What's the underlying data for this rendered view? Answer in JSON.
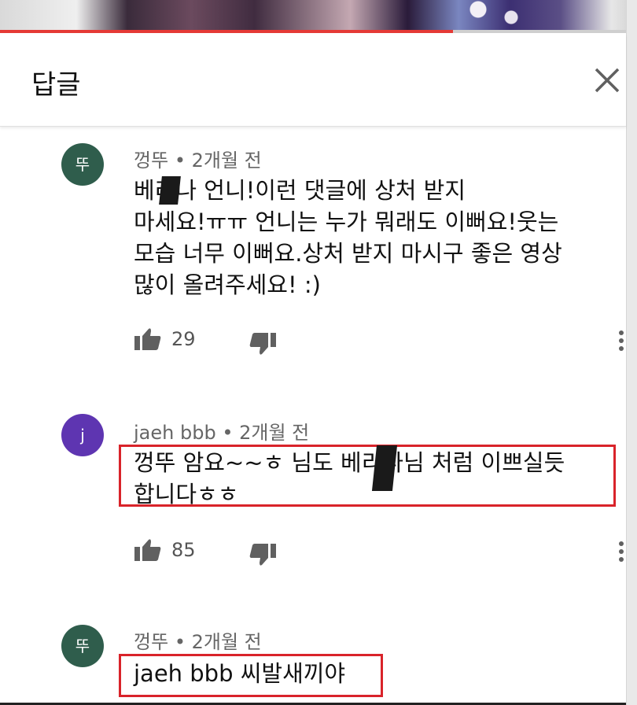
{
  "player": {
    "progress_percent": 72
  },
  "header": {
    "title": "답글"
  },
  "icons": {
    "close": "close-icon",
    "like": "thumbs-up-icon",
    "dislike": "thumbs-down-icon",
    "more": "more-vertical-icon"
  },
  "colors": {
    "avatar_1": "#2f5d4c",
    "avatar_2": "#5e35b1",
    "highlight": "#d9232a",
    "progress": "#e53935"
  },
  "comments": [
    {
      "avatar_letter": "뚜",
      "author": "껑뚜",
      "time": "2개월 전",
      "lines": [
        "베리나 언니!이런 댓글에 상처 받지",
        "마세요!ㅠㅠ 언니는 누가 뭐래도 이뻐요!웃는",
        "모습 너무 이뻐요.상처 받지 마시구 좋은 영상",
        "많이 올려주세요! :)"
      ],
      "likes": "29"
    },
    {
      "avatar_letter": "j",
      "author": "jaeh bbb",
      "time": "2개월 전",
      "lines": [
        "껑뚜 암요~~ㅎ 님도 베리나님 처럼 이쁘실듯",
        "합니다ㅎㅎ"
      ],
      "likes": "85"
    },
    {
      "avatar_letter": "뚜",
      "author": "껑뚜",
      "time": "2개월 전",
      "lines": [
        "jaeh bbb 씨발새끼야"
      ]
    }
  ]
}
